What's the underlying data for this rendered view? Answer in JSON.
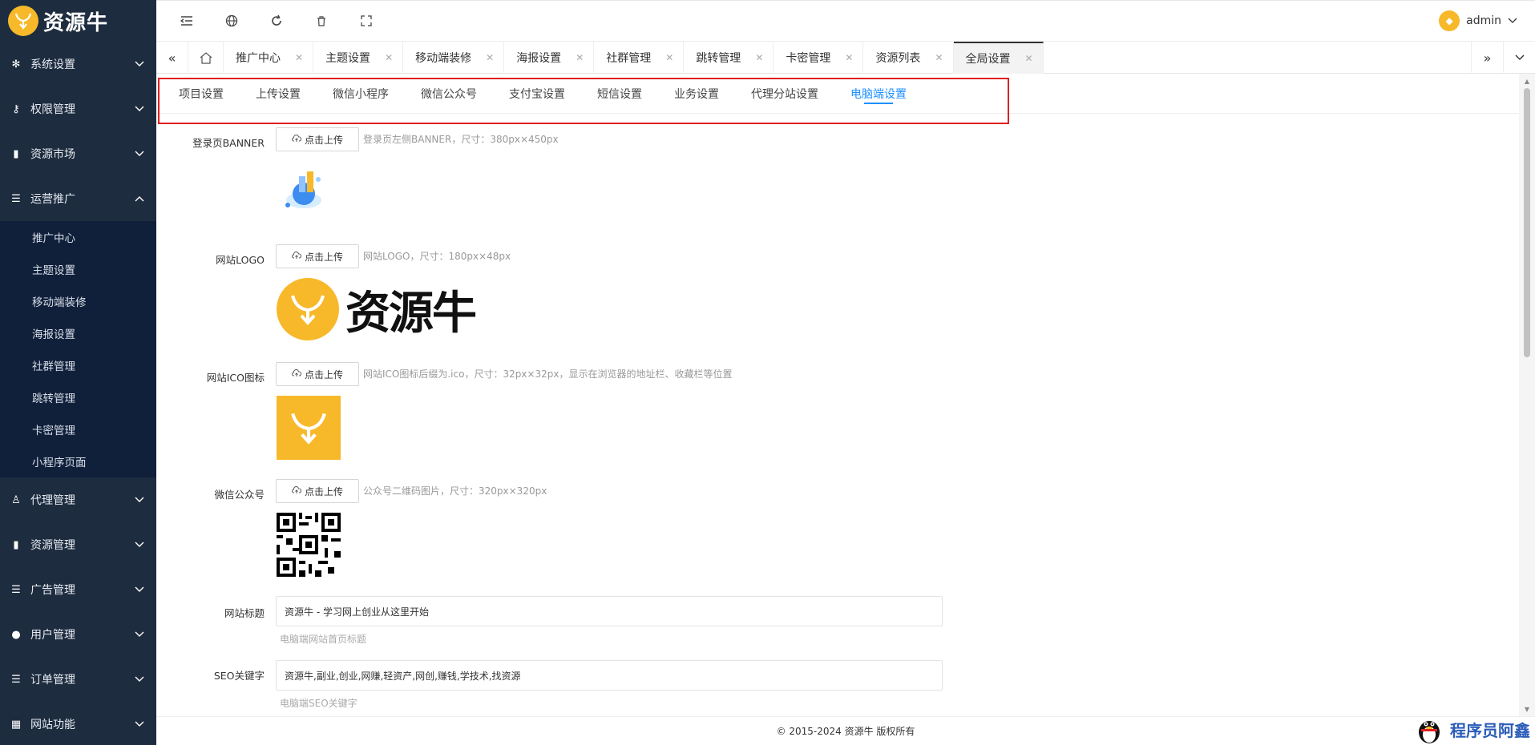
{
  "app": {
    "name": "资源牛"
  },
  "sidebar": {
    "items": [
      {
        "label": "系统设置",
        "icon": "gear-icon"
      },
      {
        "label": "权限管理",
        "icon": "key-icon"
      },
      {
        "label": "资源市场",
        "icon": "book-icon"
      },
      {
        "label": "运营推广",
        "icon": "list-icon",
        "expanded": true
      },
      {
        "label": "代理管理",
        "icon": "agent-icon"
      },
      {
        "label": "资源管理",
        "icon": "book-icon"
      },
      {
        "label": "广告管理",
        "icon": "list-icon"
      },
      {
        "label": "用户管理",
        "icon": "user-icon"
      },
      {
        "label": "订单管理",
        "icon": "list-icon"
      },
      {
        "label": "网站功能",
        "icon": "grid-icon"
      }
    ],
    "submenu": [
      "推广中心",
      "主题设置",
      "移动端装修",
      "海报设置",
      "社群管理",
      "跳转管理",
      "卡密管理",
      "小程序页面"
    ]
  },
  "header": {
    "user": "admin"
  },
  "tabs": [
    {
      "label": "推广中心"
    },
    {
      "label": "主题设置"
    },
    {
      "label": "移动端装修"
    },
    {
      "label": "海报设置"
    },
    {
      "label": "社群管理"
    },
    {
      "label": "跳转管理"
    },
    {
      "label": "卡密管理"
    },
    {
      "label": "资源列表"
    },
    {
      "label": "全局设置",
      "active": true
    }
  ],
  "subtabs": [
    {
      "label": "项目设置"
    },
    {
      "label": "上传设置"
    },
    {
      "label": "微信小程序"
    },
    {
      "label": "微信公众号"
    },
    {
      "label": "支付宝设置"
    },
    {
      "label": "短信设置"
    },
    {
      "label": "业务设置"
    },
    {
      "label": "代理分站设置"
    },
    {
      "label": "电脑端设置",
      "active": true
    }
  ],
  "form": {
    "upload_label": "点击上传",
    "banner": {
      "label": "登录页BANNER",
      "hint": "登录页左侧BANNER，尺寸：380px×450px"
    },
    "logo": {
      "label": "网站LOGO",
      "hint": "网站LOGO，尺寸：180px×48px",
      "preview_text": "资源牛"
    },
    "ico": {
      "label": "网站ICO图标",
      "hint": "网站ICO图标后缀为.ico，尺寸：32px×32px，显示在浏览器的地址栏、收藏栏等位置"
    },
    "wechat": {
      "label": "微信公众号",
      "hint": "公众号二维码图片，尺寸：320px×320px"
    },
    "site_title": {
      "label": "网站标题",
      "value": "资源牛 - 学习网上创业从这里开始",
      "hint": "电脑端网站首页标题"
    },
    "seo_keywords": {
      "label": "SEO关键字",
      "value": "资源牛,副业,创业,网赚,轻资产,网创,赚钱,学技术,找资源",
      "hint": "电脑端SEO关键字"
    }
  },
  "footer": {
    "text": "© 2015-2024 资源牛 版权所有"
  },
  "watermark": {
    "text": "程序员阿鑫"
  },
  "colors": {
    "sidebar_bg": "#1e2c3f",
    "accent": "#1e90ff",
    "brand": "#f7b92a",
    "highlight_frame": "#e02020"
  }
}
